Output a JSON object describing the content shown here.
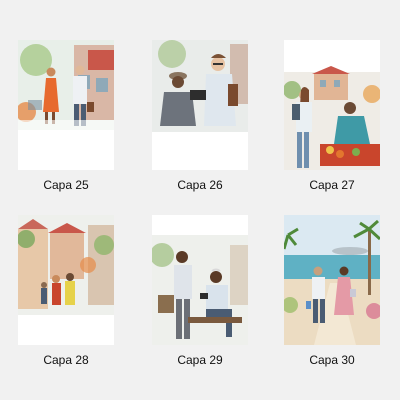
{
  "covers": [
    {
      "label": "Capa 25"
    },
    {
      "label": "Capa 26"
    },
    {
      "label": "Capa 27"
    },
    {
      "label": "Capa 28"
    },
    {
      "label": "Capa 29"
    },
    {
      "label": "Capa 30"
    }
  ],
  "colors": {
    "background": "#f1f1f1",
    "card": "#ffffff",
    "caption_text": "#111111"
  }
}
